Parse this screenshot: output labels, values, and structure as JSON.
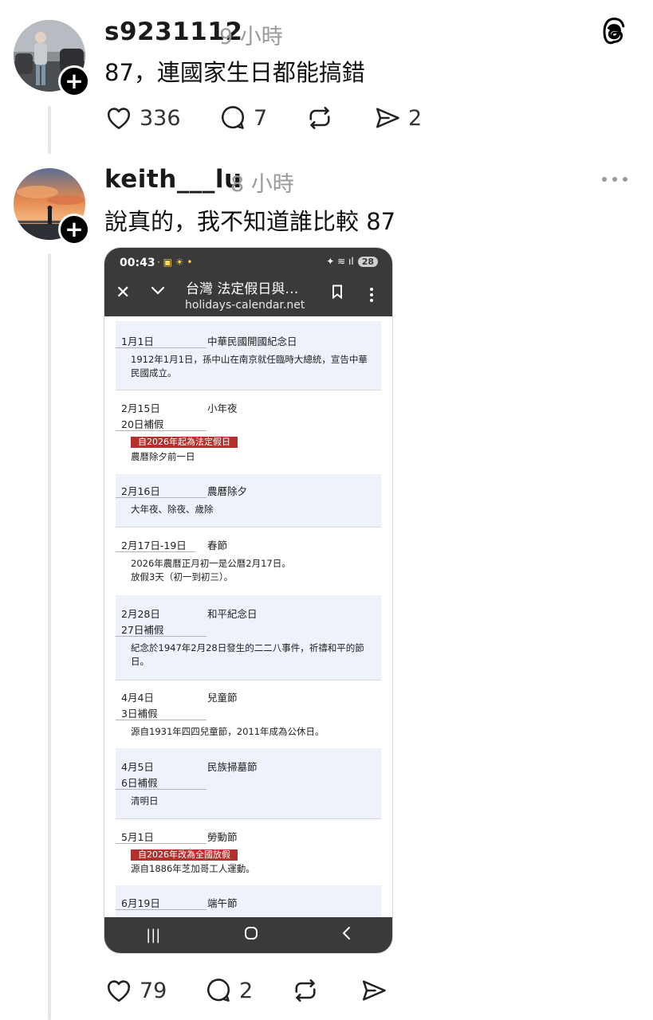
{
  "posts": [
    {
      "username": "s9231112",
      "time": "9 小時",
      "text": "87，連國家生日都能搞錯",
      "likes": "336",
      "replies": "7",
      "shares": "2"
    },
    {
      "username": "keith___lu",
      "time": "8 小時",
      "text": "說真的，我不知道誰比較 87",
      "likes": "79",
      "replies": "2"
    }
  ],
  "screenshot": {
    "status_time": "00:43",
    "battery": "28",
    "page_title": "台灣  法定假日與…",
    "url": "holidays-calendar.net",
    "holidays": [
      {
        "date": "1月1日",
        "sub": "",
        "name": "中華民國開國紀念日",
        "badge": "",
        "desc": "1912年1月1日，孫中山在南京就任臨時大總統，宣告中華民國成立。"
      },
      {
        "date": "2月15日",
        "sub": "20日補假",
        "name": "小年夜",
        "badge": "自2026年起為法定假日",
        "desc": "農曆除夕前一日"
      },
      {
        "date": "2月16日",
        "sub": "",
        "name": "農曆除夕",
        "badge": "",
        "desc": "大年夜、除夜、歲除"
      },
      {
        "date": "2月17日-19日",
        "sub": "",
        "name": "春節",
        "badge": "",
        "desc": "2026年農曆正月初一是公曆2月17日。\n放假3天（初一到初三）。"
      },
      {
        "date": "2月28日",
        "sub": "27日補假",
        "name": "和平紀念日",
        "badge": "",
        "desc": "紀念於1947年2月28日發生的二二八事件，祈禱和平的節日。"
      },
      {
        "date": "4月4日",
        "sub": "3日補假",
        "name": "兒童節",
        "badge": "",
        "desc": "源自1931年四四兒童節，2011年成為公休日。"
      },
      {
        "date": "4月5日",
        "sub": "6日補假",
        "name": "民族掃墓節",
        "badge": "",
        "desc": "清明日"
      },
      {
        "date": "5月1日",
        "sub": "",
        "name": "勞動節",
        "badge": "自2026年改為全國放假",
        "desc": "源自1886年芝加哥工人運動。"
      },
      {
        "date": "6月19日",
        "sub": "",
        "name": "端午節",
        "badge": "",
        "desc": ""
      }
    ]
  },
  "colors": {
    "accent_red": "#b4302c",
    "row_shade": "#edf2fb",
    "browser_bar": "#3a3a3a"
  },
  "icons": [
    "threads-logo-icon",
    "heart-icon",
    "comment-icon",
    "repost-icon",
    "share-icon",
    "more-icon",
    "plus-icon",
    "close-icon",
    "chevron-down-icon",
    "bookmark-icon",
    "kebab-menu-icon",
    "recents-icon",
    "home-icon",
    "back-icon"
  ]
}
